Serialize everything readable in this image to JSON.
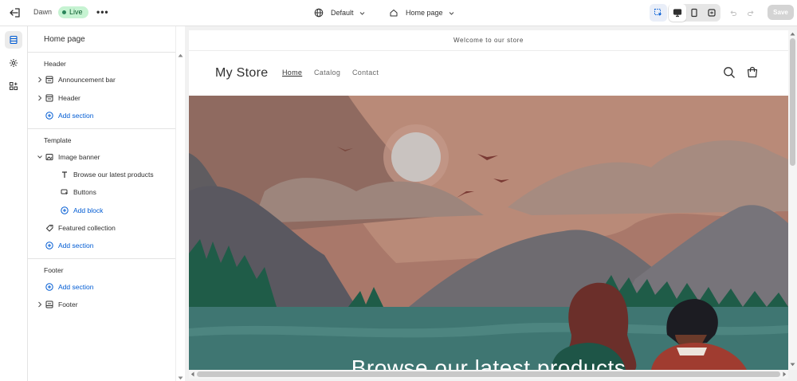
{
  "topbar": {
    "theme_name": "Dawn",
    "live_label": "Live",
    "more_label": "•••",
    "preset_label": "Default",
    "page_label": "Home page",
    "save_label": "Save"
  },
  "sidebar": {
    "title": "Home page",
    "header_group": {
      "title": "Header",
      "items": [
        {
          "label": "Announcement bar",
          "icon": "section-icon"
        },
        {
          "label": "Header",
          "icon": "section-icon"
        }
      ],
      "add_label": "Add section"
    },
    "template_group": {
      "title": "Template",
      "banner_label": "Image banner",
      "blocks": [
        {
          "label": "Browse our latest products",
          "icon": "text-icon"
        },
        {
          "label": "Buttons",
          "icon": "button-icon"
        }
      ],
      "add_block_label": "Add block",
      "featured_label": "Featured collection",
      "add_label": "Add section"
    },
    "footer_group": {
      "title": "Footer",
      "add_label": "Add section",
      "footer_label": "Footer"
    }
  },
  "preview": {
    "announcement": "Welcome to our store",
    "store_name": "My Store",
    "nav": [
      "Home",
      "Catalog",
      "Contact"
    ],
    "banner_heading": "Browse our latest products"
  },
  "colors": {
    "accent": "#005bd3",
    "live_bg": "#c6f3d2",
    "live_text": "#0b5c2e",
    "save_disabled": "#d4d4d4"
  }
}
